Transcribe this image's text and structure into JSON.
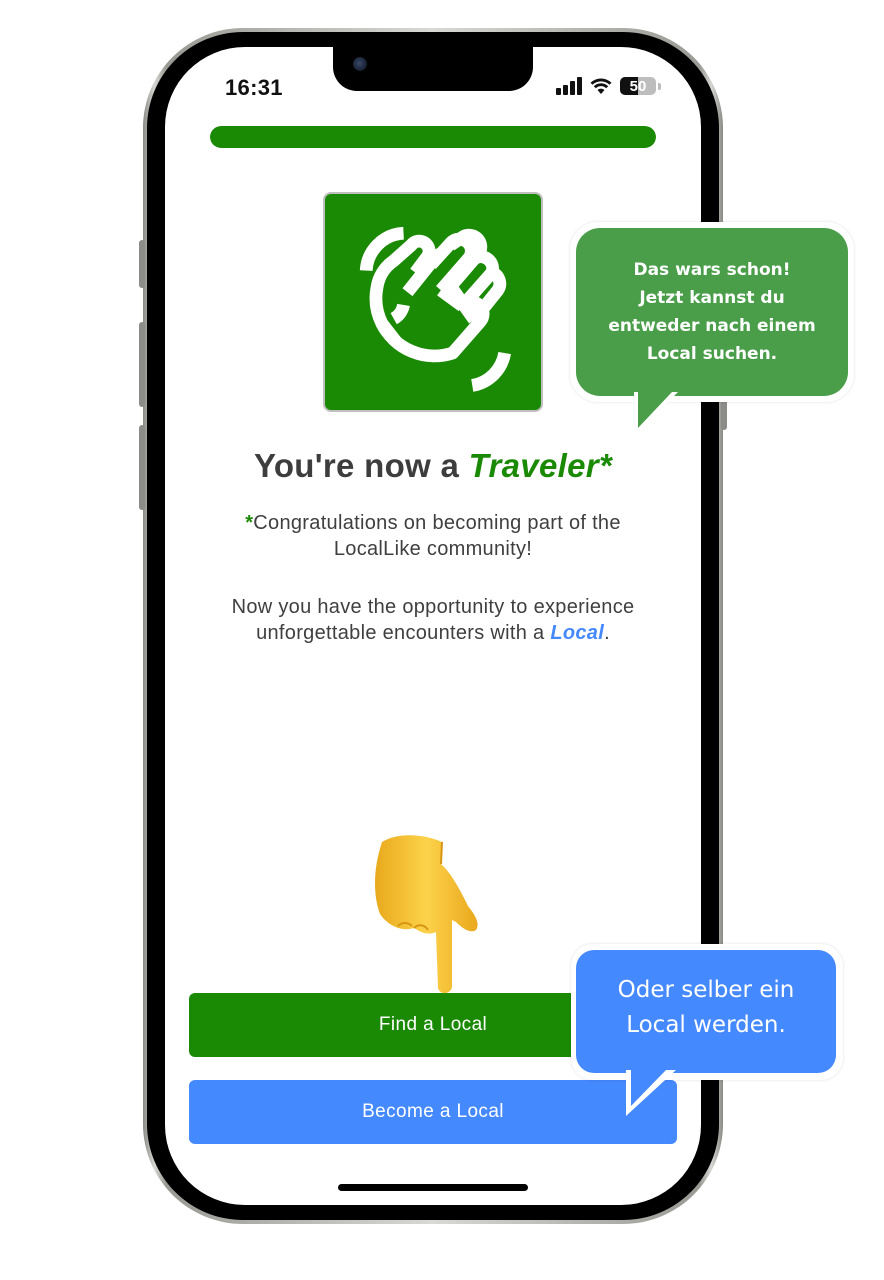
{
  "status_bar": {
    "time": "16:31",
    "battery_percent": 50,
    "battery_label": "50",
    "icons": [
      "signal-icon",
      "wifi-icon",
      "battery-icon"
    ]
  },
  "onboarding": {
    "progress_percent": 100,
    "logo_icon": "waving-hand-icon",
    "headline_prefix": "You're now a ",
    "headline_accent": "Traveler*",
    "congrats_star": "*",
    "congrats_text": "Congratulations on becoming part of the LocalLike community!",
    "opportunity_text": "Now you have the opportunity to experience unforgettable encounters with a ",
    "opportunity_link": "Local",
    "opportunity_end": "."
  },
  "actions": {
    "find_label": "Find a Local",
    "become_label": "Become a Local"
  },
  "annotations": {
    "pointer_icon": "backhand-index-pointing-down-icon",
    "green_callout": [
      "Das wars schon!",
      "Jetzt kannst du",
      "entweder nach einem",
      "Local suchen."
    ],
    "blue_callout": [
      "Oder selber ein",
      "Local werden."
    ]
  },
  "colors": {
    "brand_green": "#1a8a05",
    "brand_blue": "#4589ff",
    "callout_green": "#4a9e4a",
    "text_dark": "#3d3d3d"
  }
}
